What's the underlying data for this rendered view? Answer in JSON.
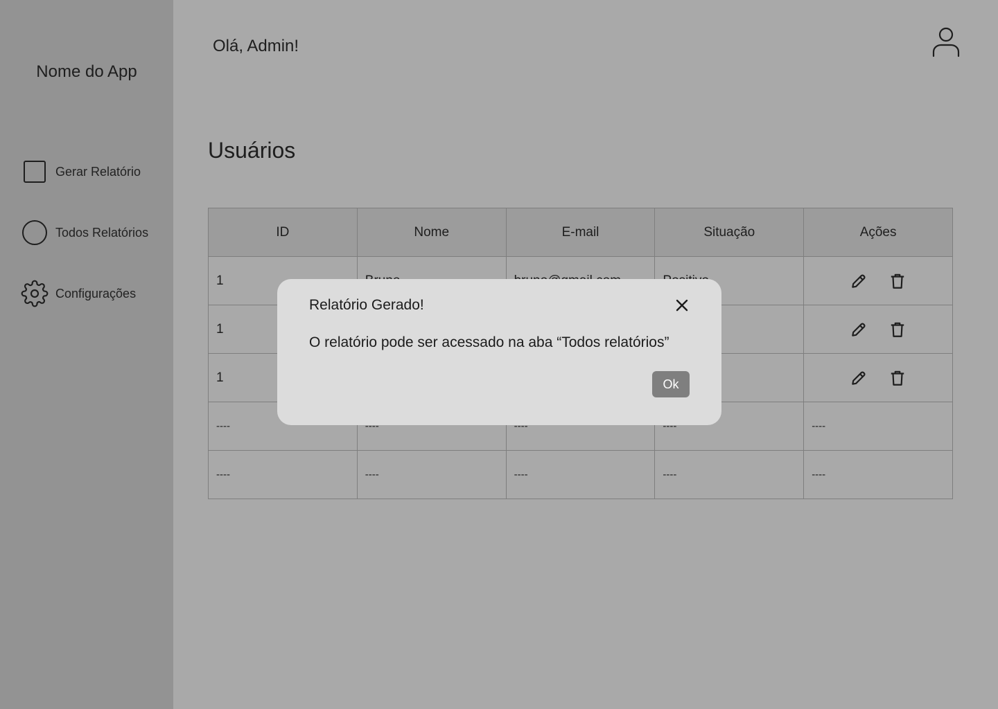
{
  "sidebar": {
    "app_name": "Nome do App",
    "items": [
      {
        "label": "Gerar Relatório",
        "icon": "square-icon"
      },
      {
        "label": "Todos Relatórios",
        "icon": "circle-icon"
      },
      {
        "label": "Configurações",
        "icon": "gear-icon"
      }
    ]
  },
  "header": {
    "greeting": "Olá, Admin!",
    "user_icon": "user-icon"
  },
  "main": {
    "title": "Usuários",
    "table": {
      "headers": [
        "ID",
        "Nome",
        "E-mail",
        "Situação",
        "Ações"
      ],
      "rows": [
        {
          "id": "1",
          "nome": "Bruno",
          "email": "bruno@gmail.com",
          "situacao": "Positivo"
        },
        {
          "id": "1",
          "nome": "",
          "email": "",
          "situacao": ""
        },
        {
          "id": "1",
          "nome": "",
          "email": "",
          "situacao": ""
        },
        {
          "id": "----",
          "nome": "----",
          "email": "----",
          "situacao": "----",
          "acoes": "----"
        },
        {
          "id": "----",
          "nome": "----",
          "email": "----",
          "situacao": "----",
          "acoes": "----"
        }
      ],
      "action_icons": [
        "pencil-icon",
        "trash-icon"
      ]
    }
  },
  "modal": {
    "title": "Relatório Gerado!",
    "message": "O relatório pode ser acessado na aba “Todos relatórios”",
    "ok_label": "Ok",
    "close_icon": "close-icon"
  },
  "colors": {
    "sidebar_bg": "#939393",
    "main_bg": "#a9a9a9",
    "table_header_bg": "#9c9c9c",
    "modal_bg": "#dcdcdc",
    "ok_button_bg": "#7f7f7f"
  }
}
